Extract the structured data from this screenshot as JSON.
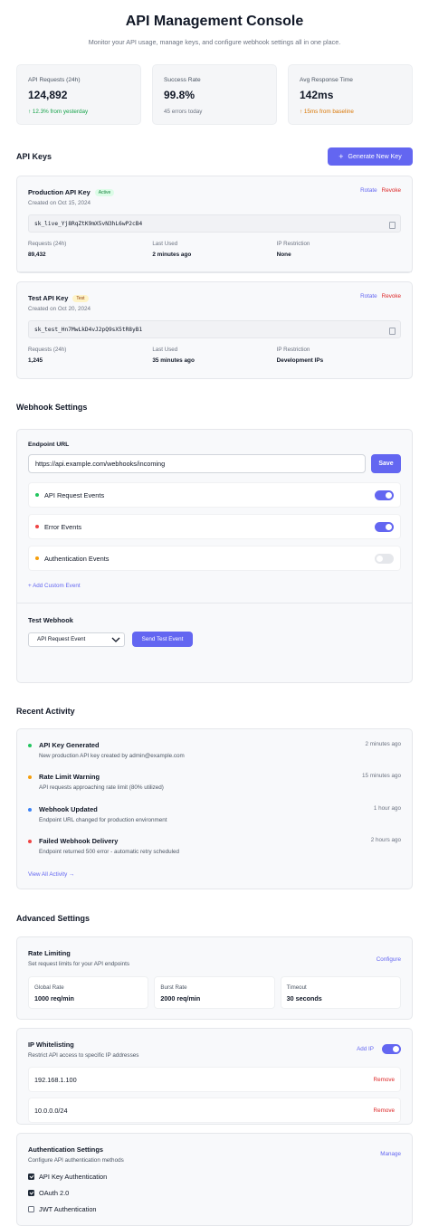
{
  "header": {
    "title": "API Management Console",
    "subtitle": "Monitor your API usage, manage keys, and configure webhook settings all in one place."
  },
  "stats": [
    {
      "label": "API Requests (24h)",
      "value": "124,892",
      "sub": "↑ 12.3% from yesterday",
      "sub_color": "#16a34a"
    },
    {
      "label": "Success Rate",
      "value": "99.8%",
      "sub": "45 errors today",
      "sub_color": "#6b7280"
    },
    {
      "label": "Avg Response Time",
      "value": "142ms",
      "sub": "↑ 15ms from baseline",
      "sub_color": "#d97706"
    }
  ],
  "api_keys": {
    "section_title": "API Keys",
    "generate_label": "Generate New Key",
    "rotate_label": "Rotate",
    "revoke_label": "Revoke",
    "meta_labels": [
      "Requests (24h)",
      "Last Used",
      "IP Restriction"
    ],
    "keys": [
      {
        "name": "Production API Key",
        "badge": "Active",
        "created": "Created on Oct 15, 2024",
        "key": "sk_live_Yj8RqZtK9mX5vN3hL6wP2cB4",
        "requests": "89,432",
        "last_used": "2 minutes ago",
        "ip_restriction": "None"
      },
      {
        "name": "Test API Key",
        "badge": "Test",
        "created": "Created on Oct 20, 2024",
        "key": "sk_test_Hn7MwLkD4vJ2pQ9sX5tR8yB1",
        "requests": "1,245",
        "last_used": "35 minutes ago",
        "ip_restriction": "Development IPs"
      }
    ]
  },
  "webhook": {
    "section_title": "Webhook Settings",
    "endpoint_label": "Endpoint URL",
    "endpoint_value": "https://api.example.com/webhooks/incoming",
    "save_label": "Save",
    "events": [
      {
        "label": "API Request Events",
        "dot_color": "#22c55e",
        "enabled": true
      },
      {
        "label": "Error Events",
        "dot_color": "#ef4444",
        "enabled": true
      },
      {
        "label": "Authentication Events",
        "dot_color": "#f59e0b",
        "enabled": false
      }
    ],
    "add_custom_label": "+ Add Custom Event",
    "test_title": "Test Webhook",
    "test_select_value": "API Request Event",
    "send_label": "Send Test Event"
  },
  "activity": {
    "section_title": "Recent Activity",
    "items": [
      {
        "title": "API Key Generated",
        "desc": "New production API key created by admin@example.com",
        "time": "2 minutes ago",
        "dot_color": "#22c55e"
      },
      {
        "title": "Rate Limit Warning",
        "desc": "API requests approaching rate limit (80% utilized)",
        "time": "15 minutes ago",
        "dot_color": "#f59e0b"
      },
      {
        "title": "Webhook Updated",
        "desc": "Endpoint URL changed for production environment",
        "time": "1 hour ago",
        "dot_color": "#3b82f6"
      },
      {
        "title": "Failed Webhook Delivery",
        "desc": "Endpoint returned 500 error - automatic retry scheduled",
        "time": "2 hours ago",
        "dot_color": "#ef4444"
      }
    ],
    "view_all_label": "View All Activity →"
  },
  "advanced": {
    "section_title": "Advanced Settings",
    "rate_limiting": {
      "title": "Rate Limiting",
      "desc": "Set request limits for your API endpoints",
      "configure_label": "Configure",
      "limits": [
        {
          "label": "Global Rate",
          "value": "1000 req/min"
        },
        {
          "label": "Burst Rate",
          "value": "2000 req/min"
        },
        {
          "label": "Timeout",
          "value": "30 seconds"
        }
      ]
    },
    "ip_whitelist": {
      "title": "IP Whitelisting",
      "desc": "Restrict API access to specific IP addresses",
      "add_label": "Add IP",
      "enabled": true,
      "remove_label": "Remove",
      "ips": [
        "192.168.1.100",
        "10.0.0.0/24"
      ]
    },
    "auth": {
      "title": "Authentication Settings",
      "desc": "Configure API authentication methods",
      "manage_label": "Manage",
      "methods": [
        {
          "label": "API Key Authentication",
          "checked": true
        },
        {
          "label": "OAuth 2.0",
          "checked": true
        },
        {
          "label": "JWT Authentication",
          "checked": false
        }
      ]
    }
  },
  "colors": {
    "accent": "#6366f1",
    "danger": "#dc2626",
    "success": "#16a34a",
    "warning": "#d97706"
  }
}
